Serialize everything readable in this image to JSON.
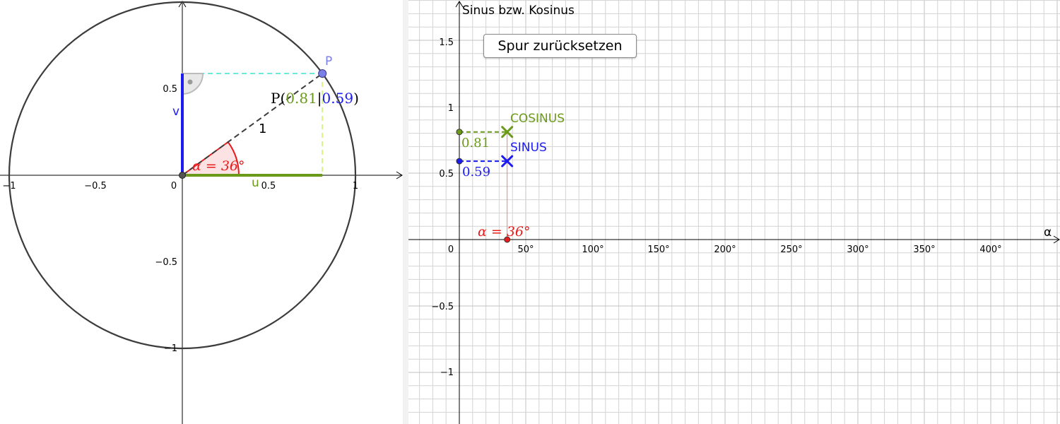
{
  "colors": {
    "circle": "#3c3c3c",
    "sin": "#1c1cf0",
    "cos": "#6b9a1a",
    "angle": "#e81c1c",
    "point": "#7a80e6",
    "guide_cyan": "#6fe6d8",
    "guide_lime": "#d6f28a",
    "grid": "#d3d3d3"
  },
  "state": {
    "angle_deg": 36,
    "cos": 0.81,
    "sin": 0.59
  },
  "left_panel": {
    "x_ticks": [
      "−1",
      "−0.5",
      "0",
      "0.5",
      "1"
    ],
    "y_ticks": [
      "0.5",
      "−0.5",
      "−1"
    ],
    "point_label": "P",
    "coord_prefix": "P(",
    "coord_cos": "0.81",
    "coord_sep": "|",
    "coord_sin": "0.59",
    "coord_suffix": ")",
    "radius_label": "1",
    "angle_label": "α = 36°",
    "v_label": "v",
    "u_label": "u"
  },
  "right_panel": {
    "y_axis_title": "Sinus bzw. Kosinus",
    "x_axis_title": "α",
    "origin_label": "0",
    "x_ticks": [
      "50°",
      "100°",
      "150°",
      "200°",
      "250°",
      "300°",
      "350°",
      "400°"
    ],
    "y_ticks": [
      "1.5",
      "1",
      "0.5",
      "−0.5",
      "−1"
    ],
    "reset_button_label": "Spur zurücksetzen",
    "cosinus_label": "COSINUS",
    "sinus_label": "SINUS",
    "cos_value_label": "0.81",
    "sin_value_label": "0.59",
    "angle_label": "α = 36°"
  }
}
